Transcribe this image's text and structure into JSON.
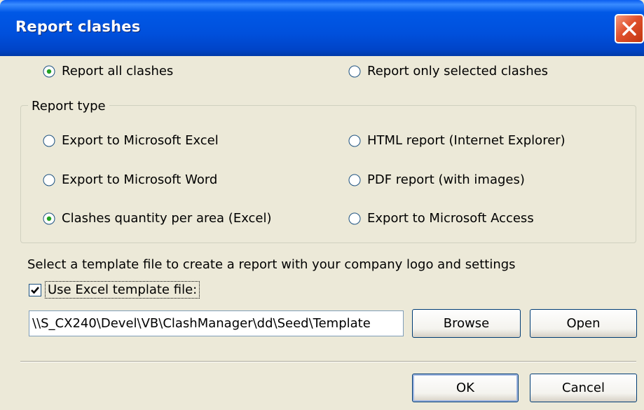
{
  "window": {
    "title": "Report clashes"
  },
  "scope": {
    "options": [
      {
        "label": "Report all clashes",
        "selected": true
      },
      {
        "label": "Report only selected clashes",
        "selected": false
      }
    ]
  },
  "report_type": {
    "legend": "Report type",
    "options": [
      {
        "label": "Export to Microsoft Excel",
        "selected": false
      },
      {
        "label": "HTML report (Internet Explorer)",
        "selected": false
      },
      {
        "label": "Export to Microsoft Word",
        "selected": false
      },
      {
        "label": "PDF report (with images)",
        "selected": false
      },
      {
        "label": "Clashes quantity per area (Excel)",
        "selected": true
      },
      {
        "label": "Export to Microsoft Access",
        "selected": false
      }
    ]
  },
  "template": {
    "hint": "Select a template file to create a report with your company logo and settings",
    "use_template_label": "Use Excel template file:",
    "use_template_checked": true,
    "path_value": "\\\\S_CX240\\Devel\\VB\\ClashManager\\dd\\Seed\\Template",
    "browse_label": "Browse",
    "open_label": "Open"
  },
  "footer": {
    "ok_label": "OK",
    "cancel_label": "Cancel"
  }
}
